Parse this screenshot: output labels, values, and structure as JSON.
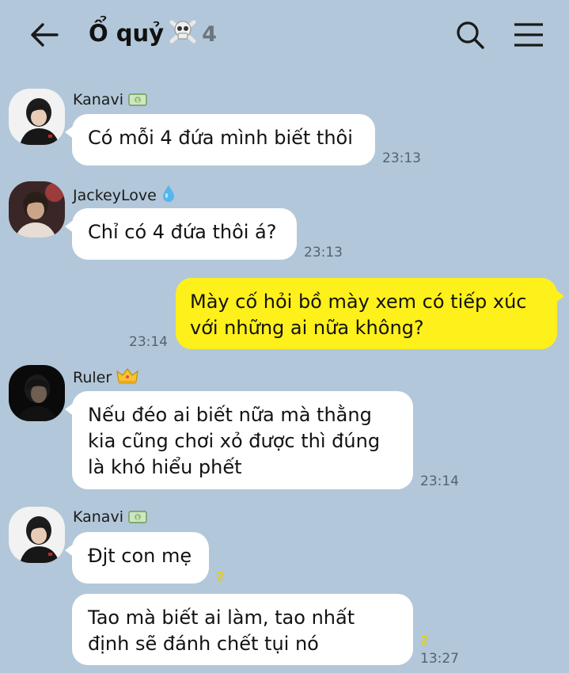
{
  "header": {
    "title": "Ổ quỷ",
    "title_emoji": "skull-icon",
    "member_count": "4",
    "icons": [
      "back-arrow-icon",
      "search-icon",
      "menu-icon"
    ]
  },
  "messages": [
    {
      "sender": "Kanavi",
      "badge": "money-icon",
      "lines": [
        "Có mỗi 4 đứa mình biết thôi"
      ],
      "time": "23:13"
    },
    {
      "sender": "JackeyLove",
      "badge": "droplet-icon",
      "lines": [
        "Chỉ có 4 đứa thôi á?"
      ],
      "time": "23:13"
    },
    {
      "sender": "",
      "mine": true,
      "lines": [
        "Mày cố hỏi bồ mày xem có tiếp xúc",
        "với những ai nữa không?"
      ],
      "time": "23:14"
    },
    {
      "sender": "Ruler",
      "badge": "crown-icon",
      "lines": [
        "Nếu đéo ai biết nữa mà thằng",
        "kia cũng chơi xỏ được thì đúng",
        "là khó hiểu phết"
      ],
      "time": "23:14"
    },
    {
      "sender": "Kanavi",
      "badge": "money-icon",
      "lines": [
        "Đjt con mẹ"
      ],
      "unread": "2"
    },
    {
      "sender": "",
      "lines": [
        "Tao mà biết ai làm, tao nhất",
        "định sẽ đánh chết tụi nó"
      ],
      "unread": "2",
      "time": "13:27"
    }
  ],
  "colors": {
    "background": "#b2c7d9",
    "my_bubble": "#fef01b",
    "their_bubble": "#ffffff",
    "unread": "#e8cd13"
  }
}
